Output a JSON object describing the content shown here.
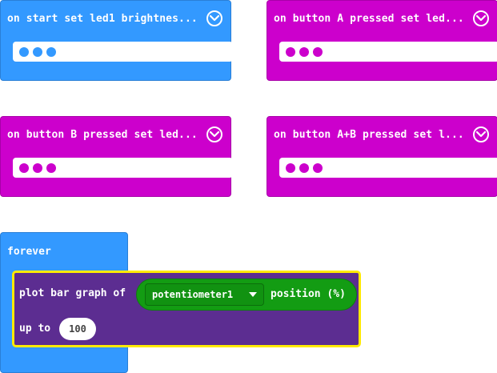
{
  "blocks": {
    "on_start": {
      "label": "on start set led1 brightnes..."
    },
    "button_a": {
      "label": "on button A pressed set led..."
    },
    "button_b": {
      "label": "on button B pressed set led..."
    },
    "button_ab": {
      "label": "on button A+B pressed set l..."
    },
    "forever": {
      "label": "forever",
      "plot": {
        "label": "plot bar graph of",
        "dropdown_value": "potentiometer1",
        "suffix": "position (%)",
        "up_to_label": "up to",
        "up_to_value": "100"
      }
    }
  },
  "colors": {
    "basic_blue": "#3399ff",
    "input_magenta": "#cc00cc",
    "led_purple": "#5c2d91",
    "pins_green": "#139c13",
    "highlight_yellow": "#ffea00"
  },
  "icons": [
    "chevron-down-circle-icon",
    "ellipsis-dots-icon",
    "dropdown-caret-icon"
  ]
}
